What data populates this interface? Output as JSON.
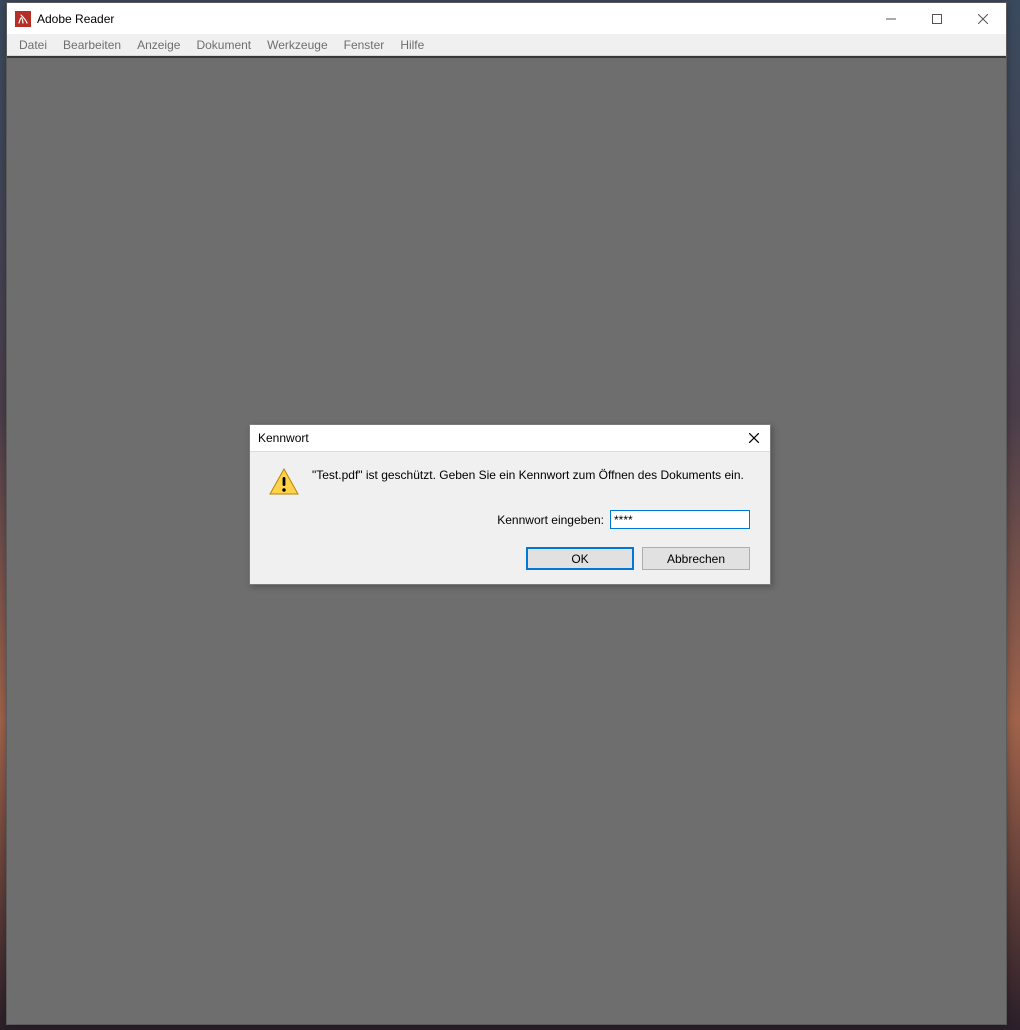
{
  "app": {
    "title": "Adobe Reader"
  },
  "menu": {
    "items": [
      "Datei",
      "Bearbeiten",
      "Anzeige",
      "Dokument",
      "Werkzeuge",
      "Fenster",
      "Hilfe"
    ]
  },
  "dialog": {
    "title": "Kennwort",
    "message": "\"Test.pdf\" ist geschützt. Geben Sie ein Kennwort zum Öffnen des Dokuments ein.",
    "password_label": "Kennwort eingeben:",
    "password_value": "****",
    "ok_label": "OK",
    "cancel_label": "Abbrechen"
  }
}
